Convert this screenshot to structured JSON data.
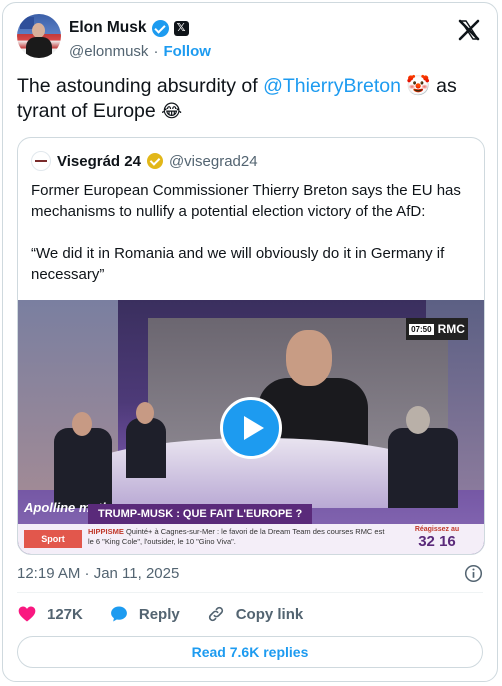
{
  "author": {
    "display_name": "Elon Musk",
    "handle": "@elonmusk",
    "separator": "·",
    "follow_label": "Follow"
  },
  "tweet": {
    "text_before": "The astounding absurdity of ",
    "mention": "@ThierryBreton",
    "text_middle": " 🤡 as tyrant of Europe ",
    "emoji_end": "😂"
  },
  "quote": {
    "display_name": "Visegrád 24",
    "handle": "@visegrad24",
    "paragraph1": "Former European Commissioner Thierry Breton says the EU has mechanisms to nullify a potential election victory of the AfD:",
    "paragraph2": "“We did it in Romania and we will obviously do it in Germany if necessary”",
    "video": {
      "channel": "RMC",
      "clock": "07:50",
      "show_logo": "Apolline matin",
      "headline": "TRUMP-MUSK : QUE FAIT L'EUROPE ?",
      "category": "Sport",
      "ticker_tag": "HIPPISME",
      "ticker_text": "Quinté+ à Cagnes-sur-Mer : le favori de la Dream Team des courses RMC est le 6 \"King Cole\", l'outsider, le 10 \"Gino Viva\".",
      "score_label": "Réagissez au",
      "score_number": "32 16"
    }
  },
  "meta": {
    "timestamp": "12:19 AM · Jan 11, 2025"
  },
  "actions": {
    "likes": "127K",
    "reply_label": "Reply",
    "copy_label": "Copy link"
  },
  "read_replies_label": "Read 7.6K replies",
  "colors": {
    "accent": "#1d9bf0",
    "like": "#f91880",
    "text_secondary": "#536471"
  }
}
